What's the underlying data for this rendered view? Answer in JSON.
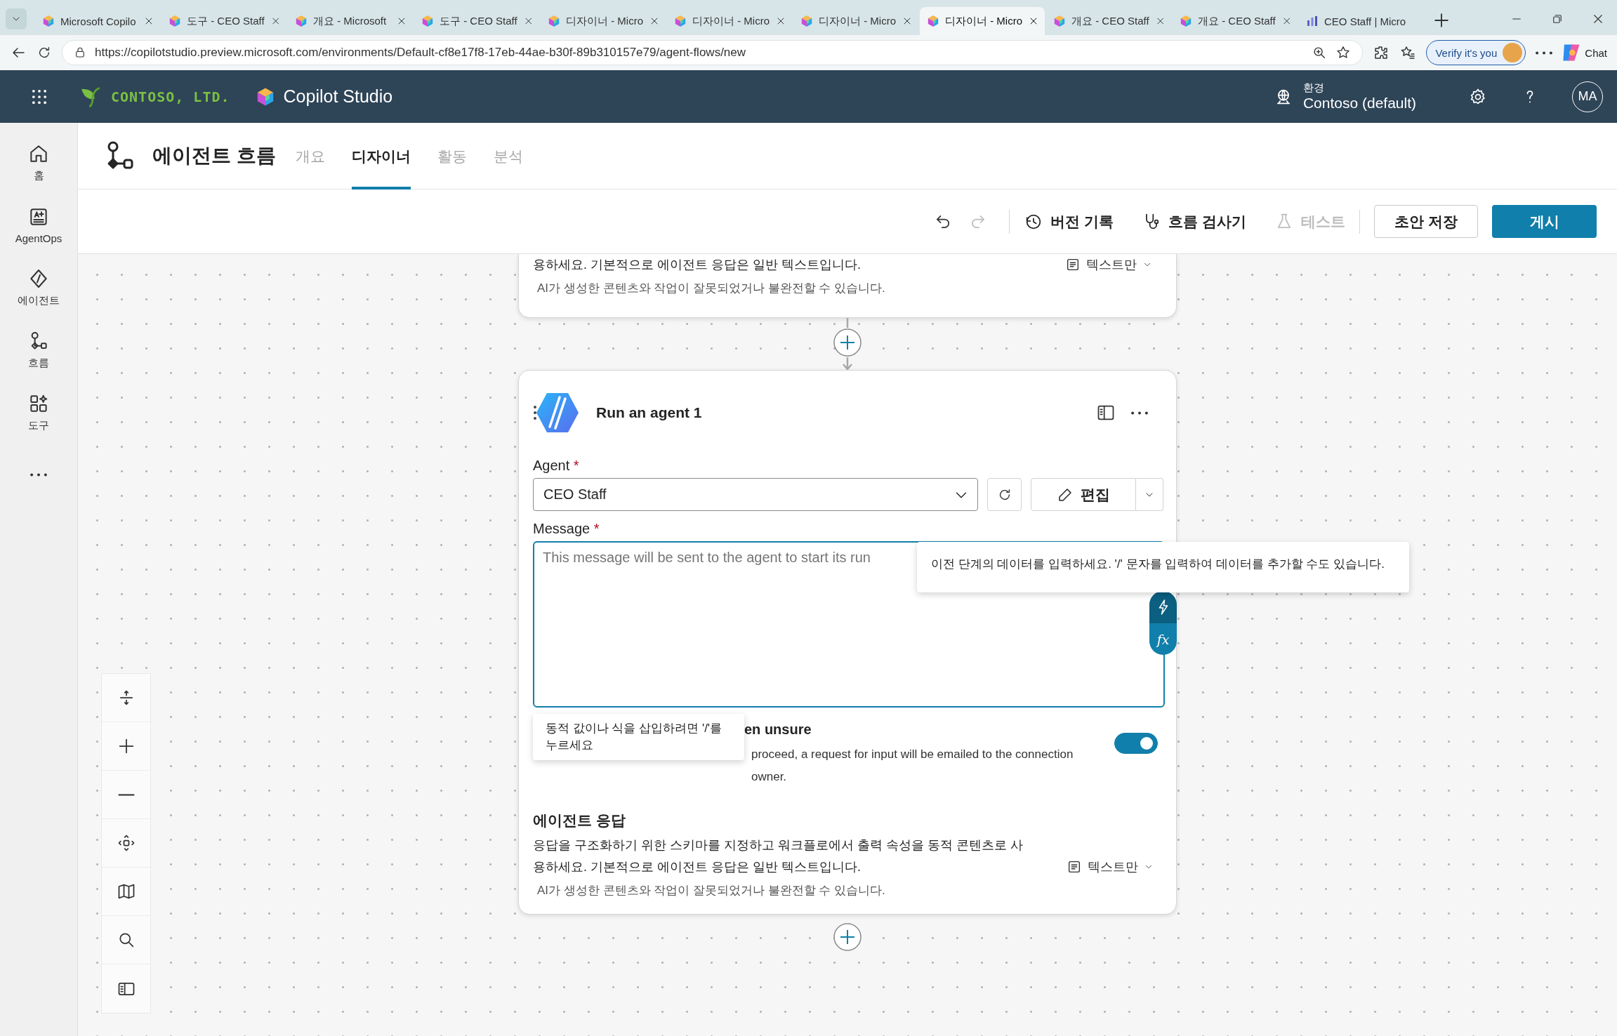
{
  "browser": {
    "tabs": [
      {
        "title": "Microsoft Copilo",
        "kind": "copilot",
        "selected": false,
        "closable": true
      },
      {
        "title": "도구 - CEO Staff",
        "kind": "copilot",
        "selected": false,
        "closable": true
      },
      {
        "title": "개요 - Microsoft",
        "kind": "copilot",
        "selected": false,
        "closable": true
      },
      {
        "title": "도구 - CEO Staff",
        "kind": "copilot",
        "selected": false,
        "closable": true
      },
      {
        "title": "디자이너 - Micro",
        "kind": "copilot",
        "selected": false,
        "closable": true
      },
      {
        "title": "디자이너 - Micro",
        "kind": "copilot",
        "selected": false,
        "closable": true
      },
      {
        "title": "디자이너 - Micro",
        "kind": "copilot",
        "selected": false,
        "closable": true
      },
      {
        "title": "디자이너 - Micro",
        "kind": "copilot",
        "selected": true,
        "closable": true
      },
      {
        "title": "개요 - CEO Staff",
        "kind": "copilot",
        "selected": false,
        "closable": true
      },
      {
        "title": "개요 - CEO Staff",
        "kind": "copilot",
        "selected": false,
        "closable": true
      },
      {
        "title": "CEO Staff | Micro",
        "kind": "chart",
        "selected": false,
        "closable": false
      }
    ],
    "url": "https://copilotstudio.preview.microsoft.com/environments/Default-cf8e17f8-17eb-44ae-b30f-89b310157e79/agent-flows/new",
    "profile_button": "Verify it's you",
    "chat_button": "Chat"
  },
  "header": {
    "company": "CONTOSO, LTD.",
    "product": "Copilot Studio",
    "environment_label": "환경",
    "environment": "Contoso (default)",
    "avatar": "MA"
  },
  "rail": [
    {
      "label": "홈",
      "kind": "home"
    },
    {
      "label": "AgentOps",
      "kind": "agentops"
    },
    {
      "label": "에이전트",
      "kind": "agents"
    },
    {
      "label": "흐름",
      "kind": "flows"
    },
    {
      "label": "도구",
      "kind": "tools"
    },
    {
      "kind": "more"
    }
  ],
  "page": {
    "title": "에이전트 흐름",
    "tabs": [
      {
        "label": "개요",
        "selected": false
      },
      {
        "label": "디자이너",
        "selected": true
      },
      {
        "label": "활동",
        "selected": false
      },
      {
        "label": "분석",
        "selected": false
      }
    ]
  },
  "toolbar": {
    "undo": {
      "disabled": false
    },
    "redo": {
      "disabled": true
    },
    "items": [
      {
        "kind": "history",
        "label": "버전 기록",
        "disabled": false
      },
      {
        "kind": "checker",
        "label": "흐름 검사기",
        "disabled": false
      },
      {
        "kind": "test",
        "label": "테스트",
        "disabled": true
      }
    ],
    "save": "초안 저장",
    "publish": "게시"
  },
  "canvas": {
    "previous_card": {
      "description": "용하세요. 기본적으로 에이전트 응답은 일반 텍스트입니다.",
      "format": "텍스트만",
      "disclaimer": "AI가 생성한 콘텐츠와 작업이 잘못되었거나 불완전할 수 있습니다."
    },
    "card": {
      "title": "Run an agent 1",
      "agent_field": {
        "label": "Agent",
        "required_mark": "*",
        "value": "CEO Staff"
      },
      "edit_button": "편집",
      "message_field": {
        "label": "Message",
        "required_mark": "*",
        "placeholder": "This message will be sent to the agent to start its run"
      },
      "message_tooltip": "이전 단계의 데이터를 입력하세요. '/' 문자를 입력하여 데이터를 추가할 수도 있습니다.",
      "expression_button": "fx",
      "insert_hint": "동적 값이나 식을 삽입하려면 '/'를 누르세요",
      "input_setting": {
        "heading": "en unsure",
        "description": "proceed, a request for input will be emailed to the connection owner.",
        "on": true
      },
      "response": {
        "heading": "에이전트 응답",
        "description": "응답을 구조화하기 위한 스키마를 지정하고 워크플로에서 출력 속성을 동적 콘텐츠로 사용하세요. 기본적으로 에이전트 응답은 일반 텍스트입니다.",
        "format": "텍스트만",
        "disclaimer": "AI가 생성한 콘텐츠와 작업이 잘못되었거나 불완전할 수 있습니다."
      }
    },
    "zoom_controls": [
      {
        "kind": "fit"
      },
      {
        "kind": "zoom-in"
      },
      {
        "kind": "zoom-out"
      },
      {
        "kind": "center"
      },
      {
        "kind": "minimap"
      },
      {
        "kind": "search"
      },
      {
        "kind": "panel"
      }
    ]
  }
}
